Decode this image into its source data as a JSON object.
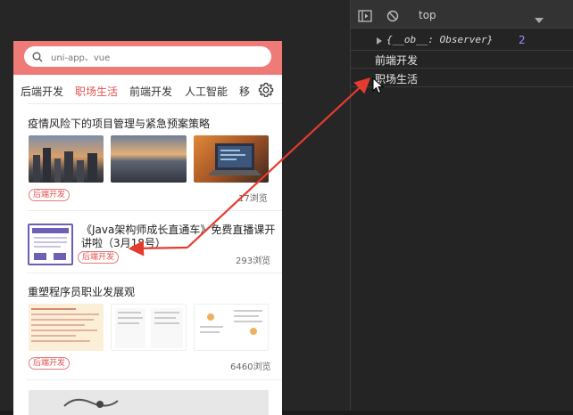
{
  "search": {
    "placeholder": "uni-app、vue"
  },
  "tabs": [
    {
      "label": "后端开发"
    },
    {
      "label": "职场生活"
    },
    {
      "label": "前端开发"
    },
    {
      "label": "人工智能"
    },
    {
      "label": "移"
    }
  ],
  "articles": [
    {
      "title": "疫情风险下的项目管理与紧急预案策略",
      "tag": "后端开发",
      "views": "17浏览"
    },
    {
      "title_line1": "《Java架构师成长直通车》免费直播课开",
      "title_line2": "讲啦（3月18号）",
      "tag": "后端开发",
      "views": "293浏览"
    },
    {
      "title": "重塑程序员职业发展观",
      "tag": "后端开发",
      "views": "6460浏览"
    }
  ],
  "devtools": {
    "context": "top",
    "object_line": "{__ob__: Observer}",
    "count": "2",
    "log_lines": [
      "前端开发",
      "职场生活"
    ]
  },
  "colors": {
    "accent": "#e0524d",
    "header": "#ee7b78",
    "arrow": "#e53b2e",
    "devtools_bg": "#242424"
  }
}
